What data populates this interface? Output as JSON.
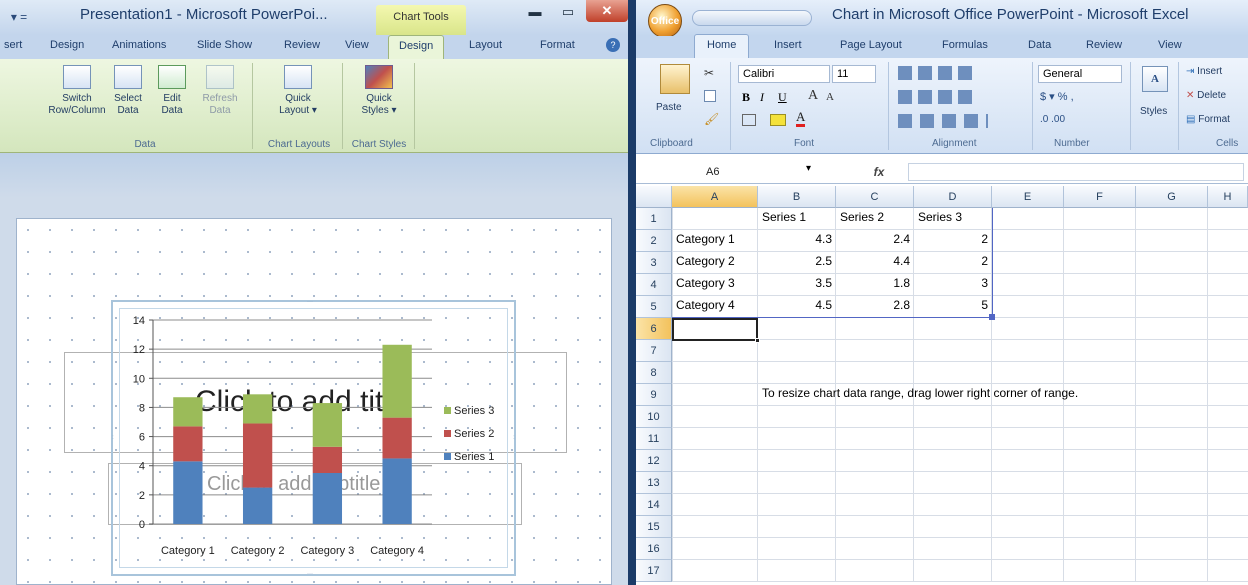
{
  "ppt": {
    "title": "Presentation1 - Microsoft PowerPoi...",
    "chart_tools": "Chart Tools",
    "tabs": [
      "sert",
      "Design",
      "Animations",
      "Slide Show",
      "Review",
      "View",
      "Design",
      "Layout",
      "Format"
    ],
    "active_tab": 6,
    "ribbon": {
      "buttons": [
        {
          "label1": "Switch",
          "label2": "Row/Column"
        },
        {
          "label1": "Select",
          "label2": "Data"
        },
        {
          "label1": "Edit",
          "label2": "Data"
        },
        {
          "label1": "Refresh",
          "label2": "Data"
        },
        {
          "label1": "Quick",
          "label2": "Layout ▾"
        },
        {
          "label1": "Quick",
          "label2": "Styles ▾"
        }
      ],
      "groups": [
        "Data",
        "Chart Layouts",
        "Chart Styles"
      ]
    },
    "slide": {
      "title_placeholder": "Click to add title",
      "subtitle_placeholder": "Click to add subtitle"
    }
  },
  "chart_data": {
    "type": "bar",
    "stacked": true,
    "categories": [
      "Category 1",
      "Category 2",
      "Category 3",
      "Category 4"
    ],
    "series": [
      {
        "name": "Series 1",
        "values": [
          4.3,
          2.5,
          3.5,
          4.5
        ],
        "color": "#4f81bd"
      },
      {
        "name": "Series 2",
        "values": [
          2.4,
          4.4,
          1.8,
          2.8
        ],
        "color": "#c0504d"
      },
      {
        "name": "Series 3",
        "values": [
          2,
          2,
          3,
          5
        ],
        "color": "#9bbb59"
      }
    ],
    "yticks": [
      0,
      2,
      4,
      6,
      8,
      10,
      12,
      14
    ],
    "ylim": [
      0,
      14
    ],
    "legend": "right",
    "grid": true
  },
  "excel": {
    "title": "Chart in Microsoft Office PowerPoint - Microsoft Excel",
    "tabs": [
      "Home",
      "Insert",
      "Page Layout",
      "Formulas",
      "Data",
      "Review",
      "View"
    ],
    "active_tab": 0,
    "ribbon": {
      "font_name": "Calibri",
      "font_size": "11",
      "number_format": "General",
      "paste": "Paste",
      "styles": "Styles",
      "insert": "Insert",
      "delete": "Delete",
      "format": "Format",
      "groups": [
        "Clipboard",
        "Font",
        "Alignment",
        "Number",
        "Cells"
      ]
    },
    "name_box": "A6",
    "fx": "fx",
    "columns": [
      "A",
      "B",
      "C",
      "D",
      "E",
      "F",
      "G",
      "H"
    ],
    "rows": [
      "1",
      "2",
      "3",
      "4",
      "5",
      "6",
      "7",
      "8",
      "9",
      "10",
      "11",
      "12",
      "13",
      "14",
      "15",
      "16",
      "17"
    ],
    "headers": [
      "Series 1",
      "Series 2",
      "Series 3"
    ],
    "data_rows": [
      {
        "label": "Category 1",
        "v1": "4.3",
        "v2": "2.4",
        "v3": "2"
      },
      {
        "label": "Category 2",
        "v1": "2.5",
        "v2": "4.4",
        "v3": "2"
      },
      {
        "label": "Category 3",
        "v1": "3.5",
        "v2": "1.8",
        "v3": "3"
      },
      {
        "label": "Category 4",
        "v1": "4.5",
        "v2": "2.8",
        "v3": "5"
      }
    ],
    "note": "To resize chart data range, drag lower right corner of range."
  }
}
